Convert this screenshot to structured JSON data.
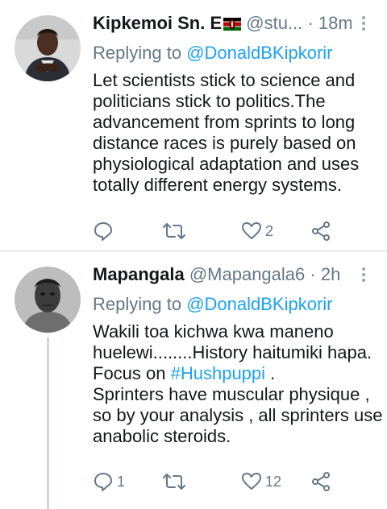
{
  "tweets": [
    {
      "name": "Kipkemoi Sn. E",
      "handle": "@stu...",
      "separator": "·",
      "time": "18m",
      "replying_prefix": "Replying to",
      "replying_to": "@DonaldBKipkorir",
      "text_lines": [
        "Let scientists stick to science and",
        "politicians stick to politics.The",
        "advancement from sprints to long",
        "distance races is purely based on",
        "physiological adaptation and uses",
        "totally different energy systems."
      ],
      "actions": {
        "reply_count": "",
        "retweet_count": "",
        "like_count": "2"
      },
      "icons": {
        "name_emoji": "kenya-flag-icon"
      }
    },
    {
      "name": "Mapangala",
      "handle": "@Mapangala6",
      "separator": "·",
      "time": "2h",
      "replying_prefix": "Replying to",
      "replying_to": "@DonaldBKipkorir",
      "text_line1": "Wakili toa kichwa kwa maneno",
      "text_line2": "huelewi........History haitumiki hapa.",
      "text_line3_prefix": "Focus on ",
      "text_hashtag": "#Hushpuppi",
      "text_line3_suffix": " .",
      "text_line4": "Sprinters have muscular physique ,",
      "text_line5": "so by your analysis , all sprinters use",
      "text_line6": "anabolic steroids.",
      "actions": {
        "reply_count": "1",
        "retweet_count": "",
        "like_count": "12"
      }
    }
  ],
  "colors": {
    "link": "#1da1f2",
    "secondary": "#657786",
    "text": "#14171a",
    "divider": "#d6d9dc"
  }
}
